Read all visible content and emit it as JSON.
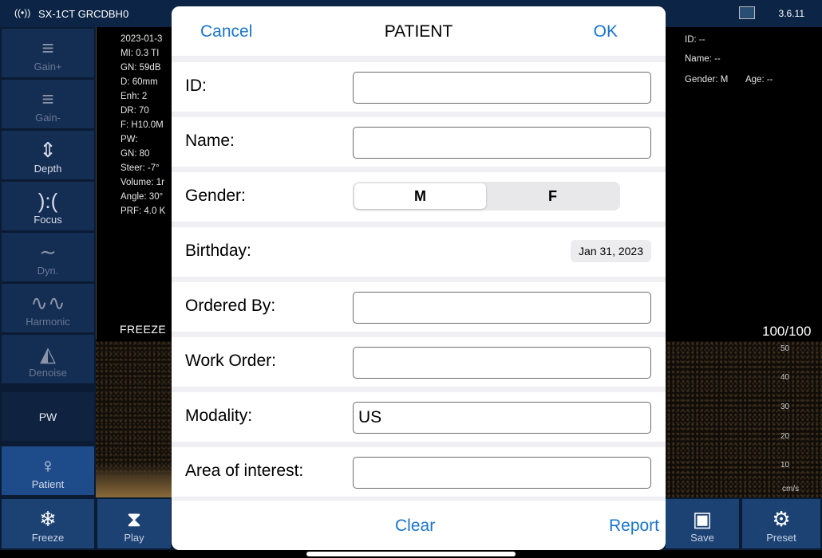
{
  "status": {
    "device": "SX-1CT GRCDBH0",
    "version": "3.6.11"
  },
  "sidebar": {
    "items": [
      {
        "label": "Gain+",
        "icon": "gain-plus-icon"
      },
      {
        "label": "Gain-",
        "icon": "gain-minus-icon"
      },
      {
        "label": "Depth",
        "icon": "depth-icon"
      },
      {
        "label": "Focus",
        "icon": "focus-icon"
      },
      {
        "label": "Dyn.",
        "icon": "dynamic-range-icon"
      },
      {
        "label": "Harmonic",
        "icon": "harmonic-icon"
      },
      {
        "label": "Denoise",
        "icon": "denoise-icon"
      },
      {
        "label": "PW",
        "icon": ""
      },
      {
        "label": "Patient",
        "icon": "patient-icon"
      }
    ]
  },
  "bottombar": {
    "freeze": "Freeze",
    "play": "Play",
    "save": "Save",
    "preset": "Preset"
  },
  "params": [
    "2023-01-3",
    "MI: 0.3  TI",
    "GN: 59dB",
    "D: 60mm",
    "Enh: 2",
    "DR: 70",
    "F: H10.0M",
    "PW:",
    "GN: 80",
    "Steer: -7°",
    "Volume: 1r",
    "Angle: 30°",
    "PRF: 4.0 K"
  ],
  "freeze_label": "FREEZE",
  "patient_info": {
    "id": "ID: --",
    "name": "Name: --",
    "gender": "Gender: M",
    "age": "Age: --"
  },
  "ratio": "100/100",
  "velocity_scale": [
    "50",
    "40",
    "30",
    "20",
    "10",
    "cm/s"
  ],
  "modal": {
    "title": "PATIENT",
    "cancel": "Cancel",
    "ok": "OK",
    "fields": {
      "id": {
        "label": "ID:",
        "value": ""
      },
      "name": {
        "label": "Name:",
        "value": ""
      },
      "gender": {
        "label": "Gender:",
        "options": [
          "M",
          "F"
        ],
        "selected": "M"
      },
      "birthday": {
        "label": "Birthday:",
        "value": "Jan 31, 2023"
      },
      "ordered_by": {
        "label": "Ordered By:",
        "value": ""
      },
      "work_order": {
        "label": "Work Order:",
        "value": ""
      },
      "modality": {
        "label": "Modality:",
        "value": "US"
      },
      "area": {
        "label": "Area of interest:",
        "value": ""
      }
    },
    "clear": "Clear",
    "report": "Report"
  },
  "colors": {
    "accent": "#1a75c9",
    "panel": "#0c2546",
    "button": "#1c4274"
  }
}
